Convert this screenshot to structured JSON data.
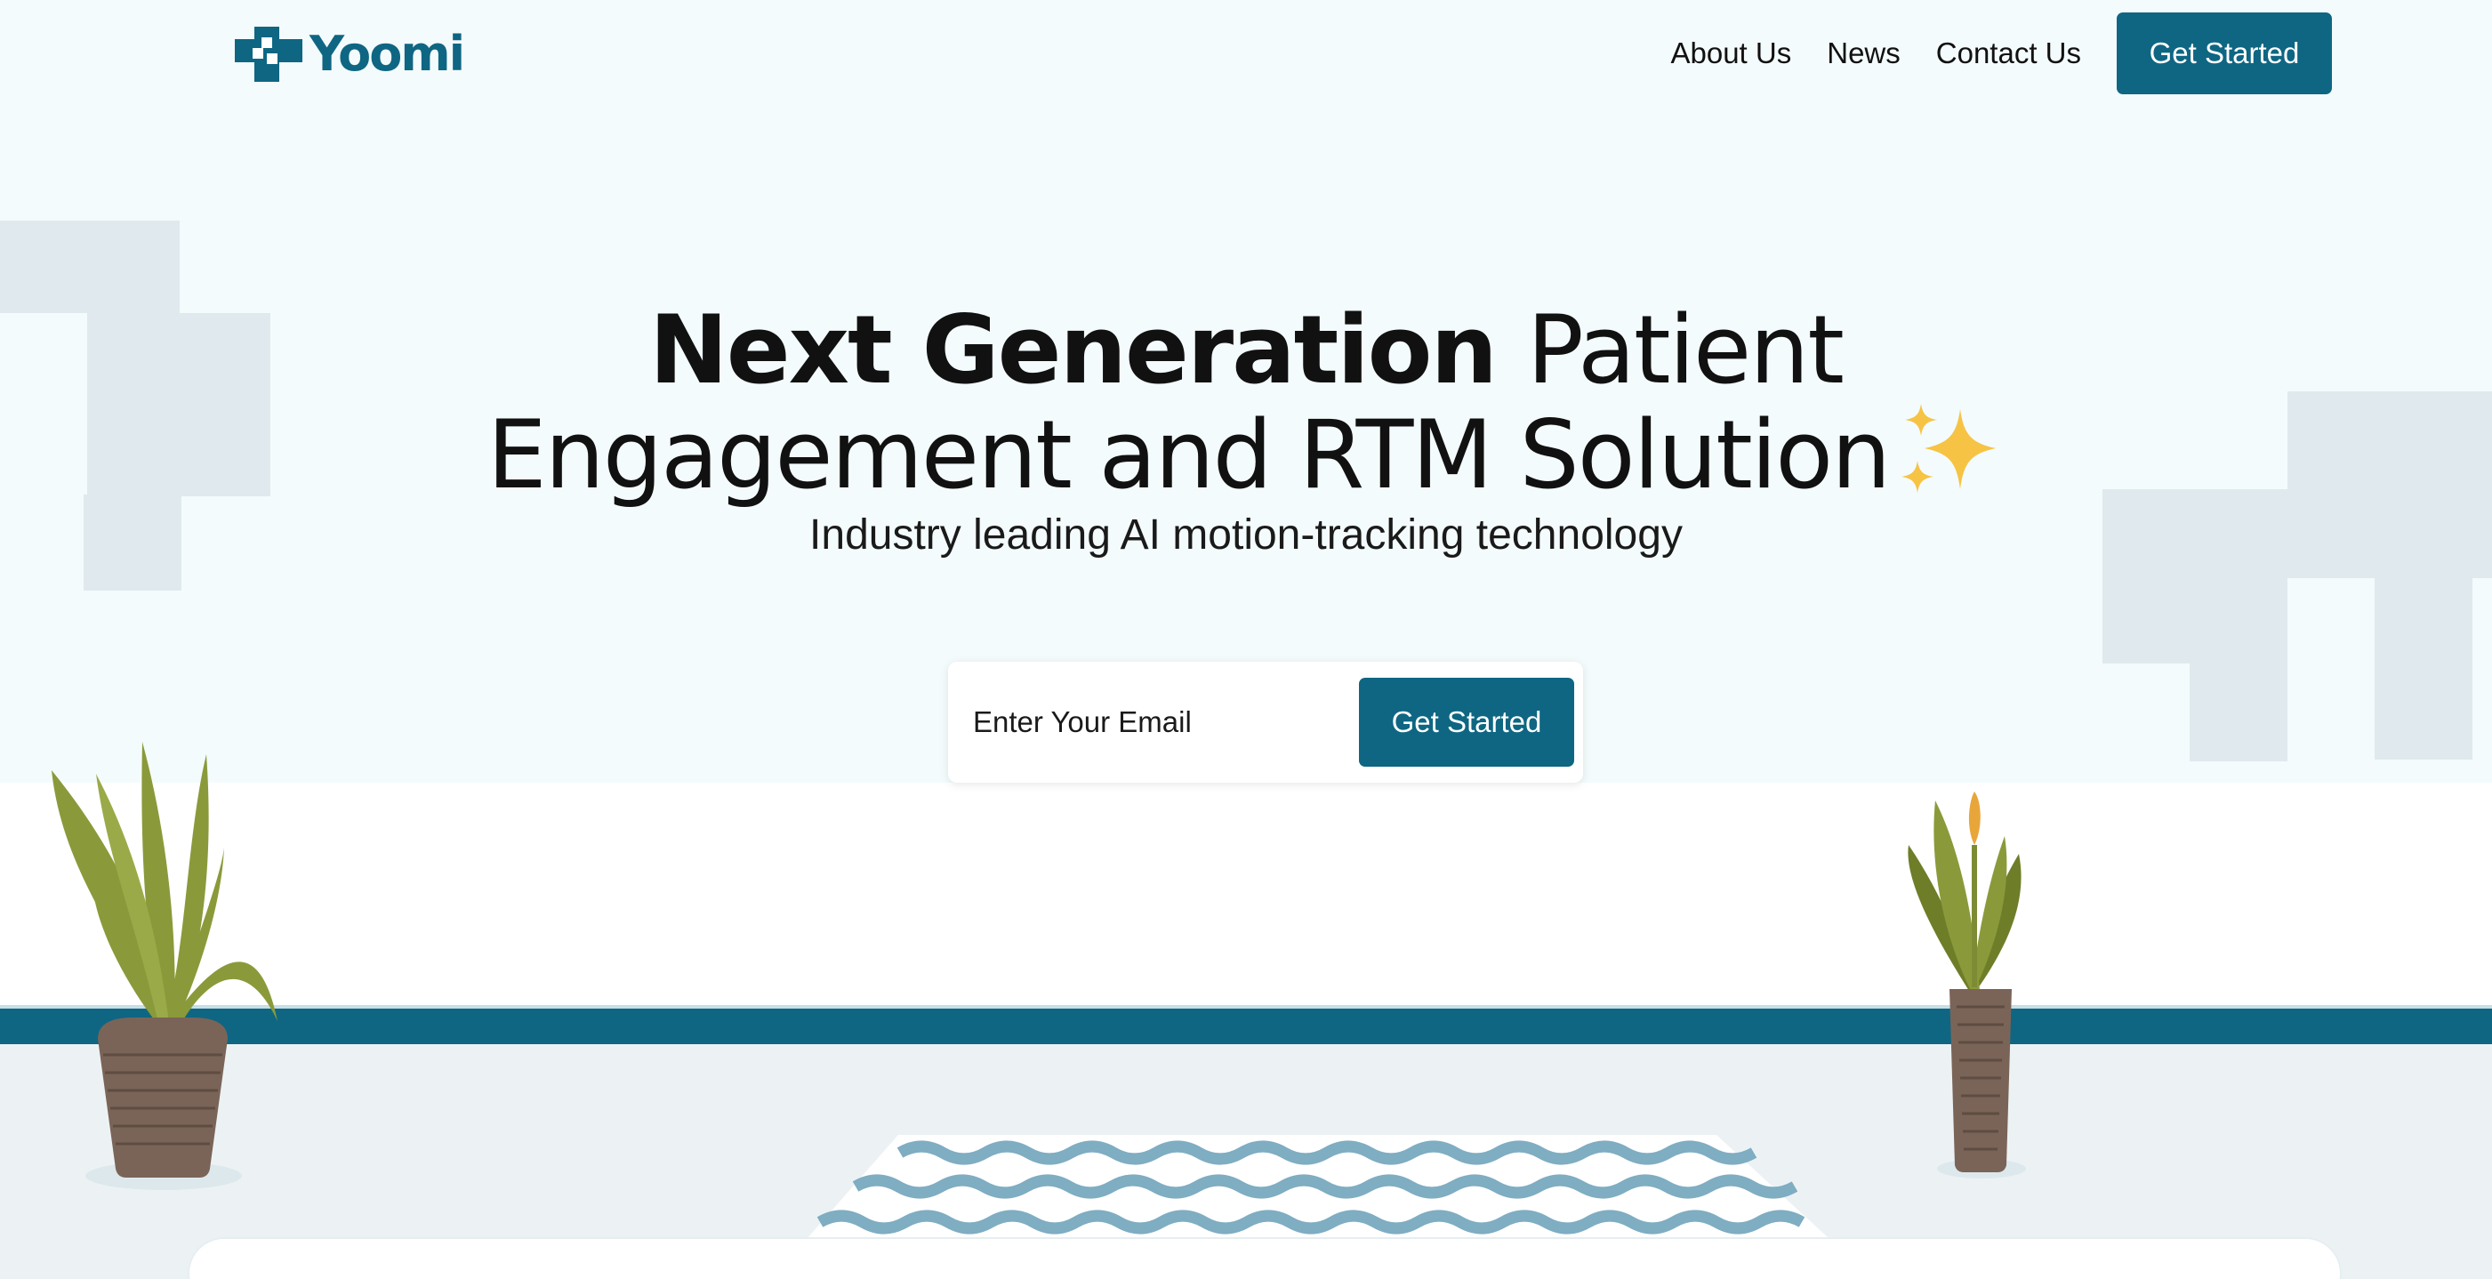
{
  "brand": {
    "name": "Yoomi",
    "color": "#0e6683"
  },
  "nav": {
    "links": [
      "About Us",
      "News",
      "Contact Us"
    ],
    "cta_label": "Get Started"
  },
  "hero": {
    "title_bold": "Next Generation",
    "title_regular_1": "Patient",
    "title_regular_2": "Engagement and RTM Solution",
    "title_icon": "sparkles-icon",
    "subtitle": "Industry leading AI motion-tracking technology"
  },
  "signup": {
    "email_placeholder": "Enter Your Email",
    "button_label": "Get Started"
  },
  "colors": {
    "accent": "#0e6683",
    "hero_background": "#f4fbfc",
    "block": "#e0e9ee",
    "sparkle": "#f6c344"
  }
}
